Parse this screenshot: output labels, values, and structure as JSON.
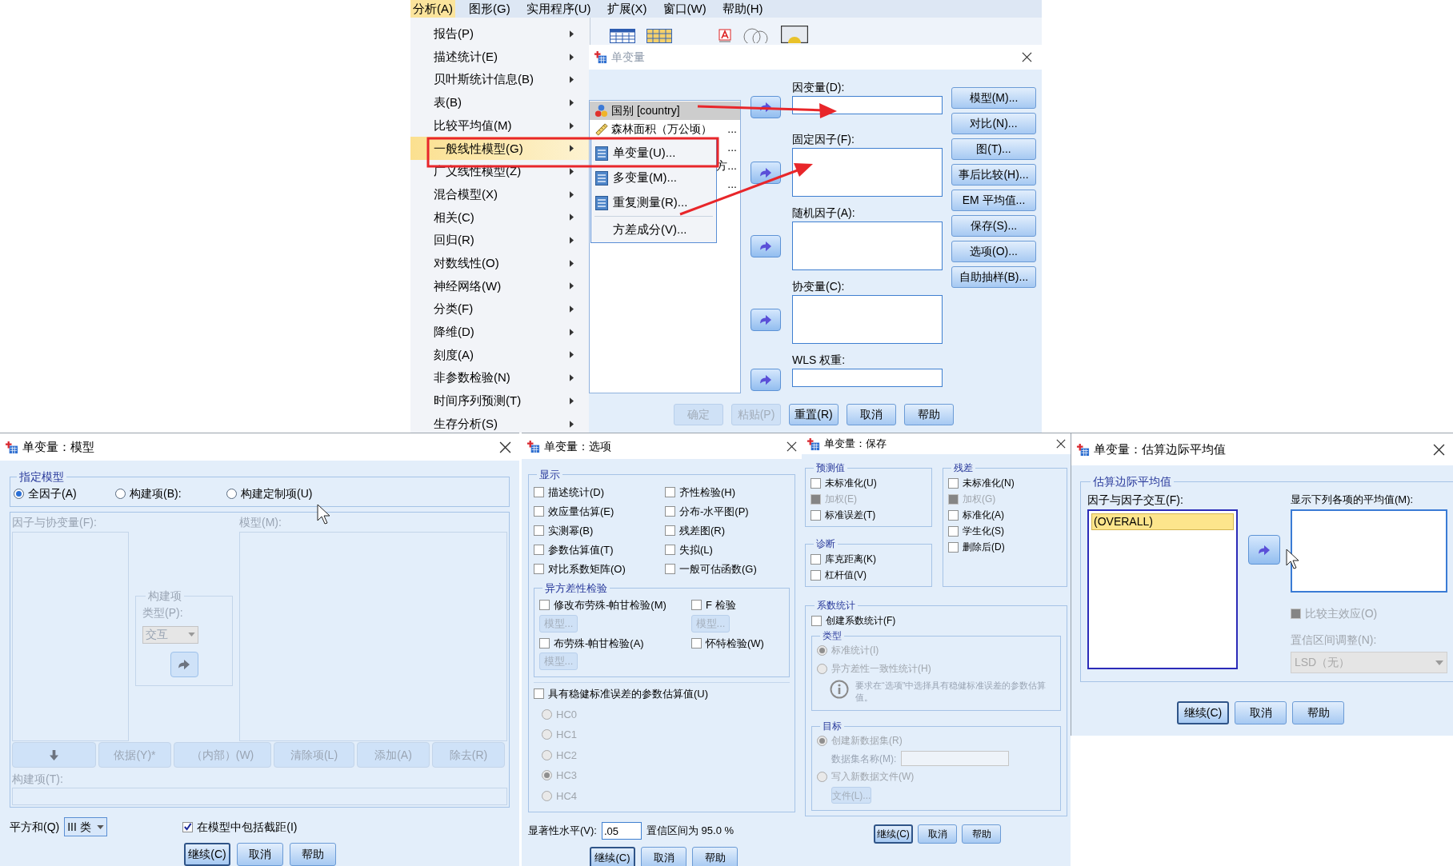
{
  "menu_bar": [
    {
      "label": "分析(A)",
      "selected": true
    },
    {
      "label": "图形(G)",
      "selected": false
    },
    {
      "label": "实用程序(U)",
      "selected": false
    },
    {
      "label": "扩展(X)",
      "selected": false
    },
    {
      "label": "窗口(W)",
      "selected": false
    },
    {
      "label": "帮助(H)",
      "selected": false
    }
  ],
  "analyze_menu": [
    {
      "label": "报告(P)",
      "selected": false
    },
    {
      "label": "描述统计(E)",
      "selected": false
    },
    {
      "label": "贝叶斯统计信息(B)",
      "selected": false
    },
    {
      "label": "表(B)",
      "selected": false
    },
    {
      "label": "比较平均值(M)",
      "selected": false
    },
    {
      "label": "一般线性模型(G)",
      "selected": true
    },
    {
      "label": "广义线性模型(Z)",
      "selected": false
    },
    {
      "label": "混合模型(X)",
      "selected": false
    },
    {
      "label": "相关(C)",
      "selected": false
    },
    {
      "label": "回归(R)",
      "selected": false
    },
    {
      "label": "对数线性(O)",
      "selected": false
    },
    {
      "label": "神经网络(W)",
      "selected": false
    },
    {
      "label": "分类(F)",
      "selected": false
    },
    {
      "label": "降维(D)",
      "selected": false
    },
    {
      "label": "刻度(A)",
      "selected": false
    },
    {
      "label": "非参数检验(N)",
      "selected": false
    },
    {
      "label": "时间序列预测(T)",
      "selected": false
    },
    {
      "label": "生存分析(S)",
      "selected": false
    }
  ],
  "glm_submenu": [
    {
      "label": "单变量(U)...",
      "kind": "glm"
    },
    {
      "label": "多变量(M)...",
      "kind": "glm"
    },
    {
      "label": "重复测量(R)...",
      "kind": "glm"
    },
    {
      "label": "方差成分(V)...",
      "kind": "plain"
    }
  ],
  "univariate": {
    "title": "单变量",
    "variables": [
      {
        "label": "国别 [country]",
        "kind": "nominal",
        "selected": true
      },
      {
        "label": "森林面积（万公顷）",
        "tail": "...",
        "kind": "scale",
        "selected": false
      },
      {
        "tail": "...",
        "selected": false
      },
      {
        "tail": "方...",
        "selected": false
      },
      {
        "tail": "...",
        "selected": false
      }
    ],
    "targets": [
      {
        "label": "因变量(D):",
        "kind": "single"
      },
      {
        "label": "固定因子(F):",
        "kind": "list"
      },
      {
        "label": "随机因子(A):",
        "kind": "list"
      },
      {
        "label": "协变量(C):",
        "kind": "list"
      },
      {
        "label": "WLS 权重:",
        "kind": "single"
      }
    ],
    "side_buttons": [
      "模型(M)...",
      "对比(N)...",
      "图(T)...",
      "事后比较(H)...",
      "EM 平均值...",
      "保存(S)...",
      "选项(O)...",
      "自助抽样(B)..."
    ],
    "buttons": [
      {
        "label": "确定",
        "disabled": true
      },
      {
        "label": "粘贴(P)",
        "disabled": true
      },
      {
        "label": "重置(R)",
        "disabled": false
      },
      {
        "label": "取消",
        "disabled": false
      },
      {
        "label": "帮助",
        "disabled": false
      }
    ]
  },
  "model_dialog": {
    "title": "单变量：模型",
    "group": "指定模型",
    "radios": [
      {
        "label": "全因子(A)",
        "selected": true
      },
      {
        "label": "构建项(B):",
        "selected": false
      },
      {
        "label": "构建定制项(U)",
        "selected": false
      }
    ],
    "factors_label": "因子与协变量(F):",
    "model_label": "模型(M):",
    "build_group": {
      "title": "构建项",
      "type_label": "类型(P):",
      "type_value": "交互"
    },
    "term_buttons": [
      {
        "kind": "icon"
      },
      {
        "kind": "text",
        "label": "依据(Y)*"
      },
      {
        "kind": "text",
        "label": "（内部）(W)"
      },
      {
        "kind": "text",
        "label": "清除项(L)"
      },
      {
        "kind": "text",
        "label": "添加(A)"
      },
      {
        "kind": "text",
        "label": "除去(R)"
      }
    ],
    "terms_label": "构建项(T):",
    "sum_of_squares": {
      "label": "平方和(Q)",
      "value": "III 类"
    },
    "intercept": {
      "label": "在模型中包括截距(I)",
      "checked": true
    },
    "buttons": [
      "继续(C)",
      "取消",
      "帮助"
    ]
  },
  "options_dialog": {
    "title": "单变量：选项",
    "display_group": "显示",
    "display": [
      {
        "label": "描述统计(D)",
        "checked": false
      },
      {
        "label": "齐性检验(H)",
        "checked": false
      },
      {
        "label": "效应量估算(E)",
        "checked": false
      },
      {
        "label": "分布-水平图(P)",
        "checked": false
      },
      {
        "label": "实测幂(B)",
        "checked": false
      },
      {
        "label": "残差图(R)",
        "checked": false
      },
      {
        "label": "参数估算值(T)",
        "checked": false
      },
      {
        "label": "失拟(L)",
        "checked": false
      },
      {
        "label": "对比系数矩阵(O)",
        "checked": false
      },
      {
        "label": "一般可估函数(G)",
        "checked": false
      }
    ],
    "hetero_group": "异方差性检验",
    "hetero_tests": [
      {
        "label": "修改布劳殊-帕甘检验(M)",
        "checked": false,
        "model_button": "模型..."
      },
      {
        "label": "F 检验",
        "checked": false,
        "model_button": "模型..."
      },
      {
        "label": "布劳殊-帕甘检验(A)",
        "checked": false,
        "model_button": "模型..."
      },
      {
        "label": "怀特检验(W)",
        "checked": false
      }
    ],
    "robust": {
      "label": "具有稳健标准误差的参数估算值(U)",
      "checked": false
    },
    "hc_options": [
      {
        "label": "HC0",
        "selected": false
      },
      {
        "label": "HC1",
        "selected": false
      },
      {
        "label": "HC2",
        "selected": false
      },
      {
        "label": "HC3",
        "selected": true
      },
      {
        "label": "HC4",
        "selected": false
      }
    ],
    "significance_label": "显著性水平(V):",
    "significance_value": ".05",
    "confidence_text": "置信区间为 95.0 %",
    "buttons": [
      "继续(C)",
      "取消",
      "帮助"
    ]
  },
  "save_dialog": {
    "title": "单变量：保存",
    "predicted": {
      "title": "预测值",
      "items": [
        {
          "label": "未标准化(U)",
          "checked": false,
          "disabled": false
        },
        {
          "label": "加权(E)",
          "checked": false,
          "disabled": true
        },
        {
          "label": "标准误差(T)",
          "checked": false,
          "disabled": false
        }
      ]
    },
    "diagnostics": {
      "title": "诊断",
      "items": [
        {
          "label": "库克距离(K)",
          "checked": false
        },
        {
          "label": "杠杆值(V)",
          "checked": false
        }
      ]
    },
    "residuals": {
      "title": "残差",
      "items": [
        {
          "label": "未标准化(N)",
          "checked": false,
          "disabled": false
        },
        {
          "label": "加权(G)",
          "checked": false,
          "disabled": true
        },
        {
          "label": "标准化(A)",
          "checked": false,
          "disabled": false
        },
        {
          "label": "学生化(S)",
          "checked": false,
          "disabled": false
        },
        {
          "label": "删除后(D)",
          "checked": false,
          "disabled": false
        }
      ]
    },
    "coef": {
      "title": "系数统计",
      "create": {
        "label": "创建系数统计(F)",
        "checked": false
      },
      "type": {
        "title": "类型",
        "options": [
          {
            "label": "标准统计(I)",
            "selected": true
          },
          {
            "label": "异方差性一致性统计(H)",
            "selected": false
          }
        ],
        "info": "要求在“选项”中选择具有稳健标准误差的参数估算值。"
      },
      "target": {
        "title": "目标",
        "options": [
          {
            "label": "创建新数据集(R)",
            "selected": true
          },
          {
            "label": "写入新数据文件(W)",
            "selected": false
          }
        ],
        "dataset_label": "数据集名称(M):",
        "file_button": "文件(L)..."
      }
    },
    "buttons": [
      "继续(C)",
      "取消",
      "帮助"
    ]
  },
  "emm_dialog": {
    "title": "单变量：估算边际平均值",
    "group": "估算边际平均值",
    "factors_label": "因子与因子交互(F):",
    "factors": [
      {
        "label": "(OVERALL)",
        "selected": true
      }
    ],
    "means_label": "显示下列各项的平均值(M):",
    "compare": {
      "label": "比较主效应(O)",
      "checked": false,
      "disabled": true
    },
    "ci_label": "置信区间调整(N):",
    "ci_value": "LSD（无）",
    "buttons": [
      "继续(C)",
      "取消",
      "帮助"
    ]
  }
}
